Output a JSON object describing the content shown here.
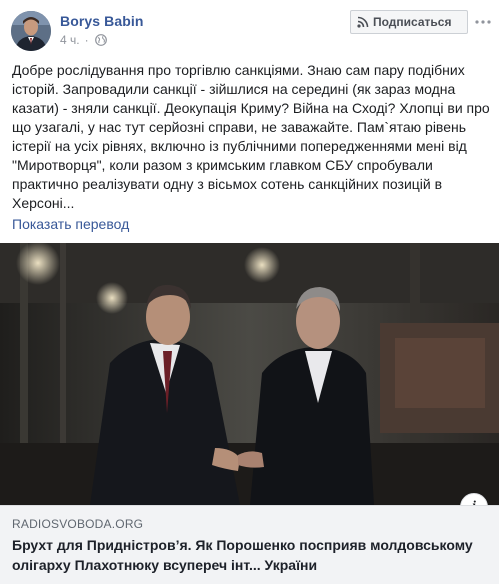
{
  "post": {
    "author": "Borys Babin",
    "time": "4 ч.",
    "separator": "·",
    "audience_icon": "globe-icon",
    "subscribe_label": "Подписаться",
    "subscribe_icon": "rss-icon",
    "more_icon": "ellipsis-icon",
    "text": "Добре рослідування про торгівлю санкціями. Знаю сам пару подібних історій. Запровадили санкції - зійшлися на середині (як зараз модна казати) - зняли санкції. Деокупація Криму? Війна на Сході? Хлопці ви про що узагалі, у нас тут серйозні справи, не заважайте. Пам`ятаю рівень істерії на усіх рівнях, включно із публічними попередженнями мені від \"Миротворця\", коли разом з кримським главком СБУ спробували практично реалізувати одну з вісьмох сотень санкційних позицій в Херсоні...",
    "translate_label": "Показать перевод"
  },
  "link_preview": {
    "domain": "RADIOSVOBODA.ORG",
    "headline": "Брухт для Придністров’я. Як Порошенко посприяв молдовському олігарху Плахотнюку всупереч інт... України",
    "info_label": "i"
  },
  "colors": {
    "link_blue": "#385898",
    "meta_gray": "#90949c",
    "caption_bg": "#f2f3f5"
  }
}
